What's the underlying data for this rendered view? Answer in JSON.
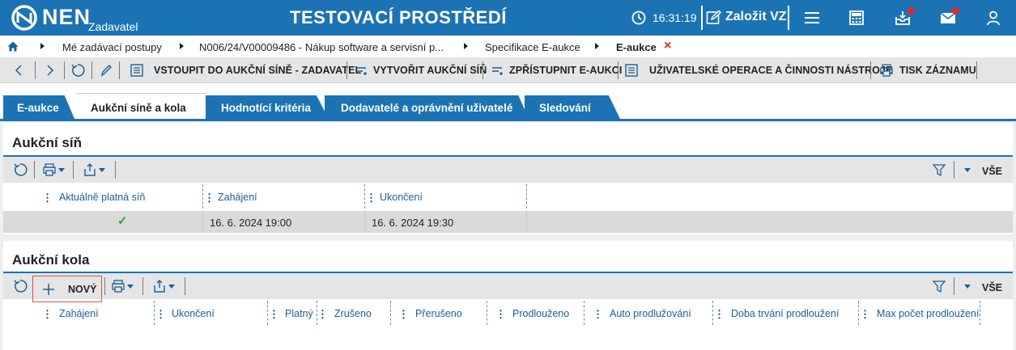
{
  "header": {
    "brand": "NEN",
    "brand_sub": "Zadavatel",
    "env_title": "TESTOVACÍ PROSTŘEDÍ",
    "time": "16:31:19",
    "create_label": "Založit VZ"
  },
  "breadcrumb": {
    "items": [
      "Mé zadávací postupy",
      "N006/24/V00009486 - Nákup software a servisní p...",
      "Specifikace E-aukce",
      "E-aukce"
    ],
    "close": "×"
  },
  "toolbar": {
    "enter_hall": "VSTOUPIT DO AUKČNÍ SÍNĚ - ZADAVATEL",
    "create_auction": "VYTVOŘIT AUKČNÍ SÍŇ",
    "publish_auction": "ZPŘÍSTUPNIT E-AUKCI",
    "user_ops": "UŽIVATELSKÉ OPERACE A ČINNOSTI NÁSTROJE",
    "print_record": "TISK ZÁZNAMU"
  },
  "tabs": [
    "E-aukce",
    "Aukční síně a kola",
    "Hodnotící kritéria",
    "Dodavatelé a oprávnění uživatelé",
    "Sledování"
  ],
  "hall_panel": {
    "title": "Aukční síň",
    "all_label": "VŠE",
    "columns": [
      "Aktuálně platná síň",
      "Zahájení",
      "Ukončení"
    ],
    "rows": [
      {
        "valid": "✓",
        "start": "16. 6. 2024 19:00",
        "end": "16. 6. 2024 19:30"
      }
    ]
  },
  "rounds_panel": {
    "title": "Aukční kola",
    "new_label": "NOVÝ",
    "all_label": "VŠE",
    "columns": [
      "Zahájení",
      "Ukončení",
      "Platný",
      "Zrušeno",
      "Přerušeno",
      "Prodlouženo",
      "Auto prodlužování",
      "Doba trvání prodloužení",
      "Max počet prodloužení"
    ]
  },
  "colors": {
    "brand_blue": "#1c73b4",
    "toolbar_gray": "#e4e5e7",
    "alert_red": "#e3262b",
    "check_green": "#2e9e3a"
  }
}
